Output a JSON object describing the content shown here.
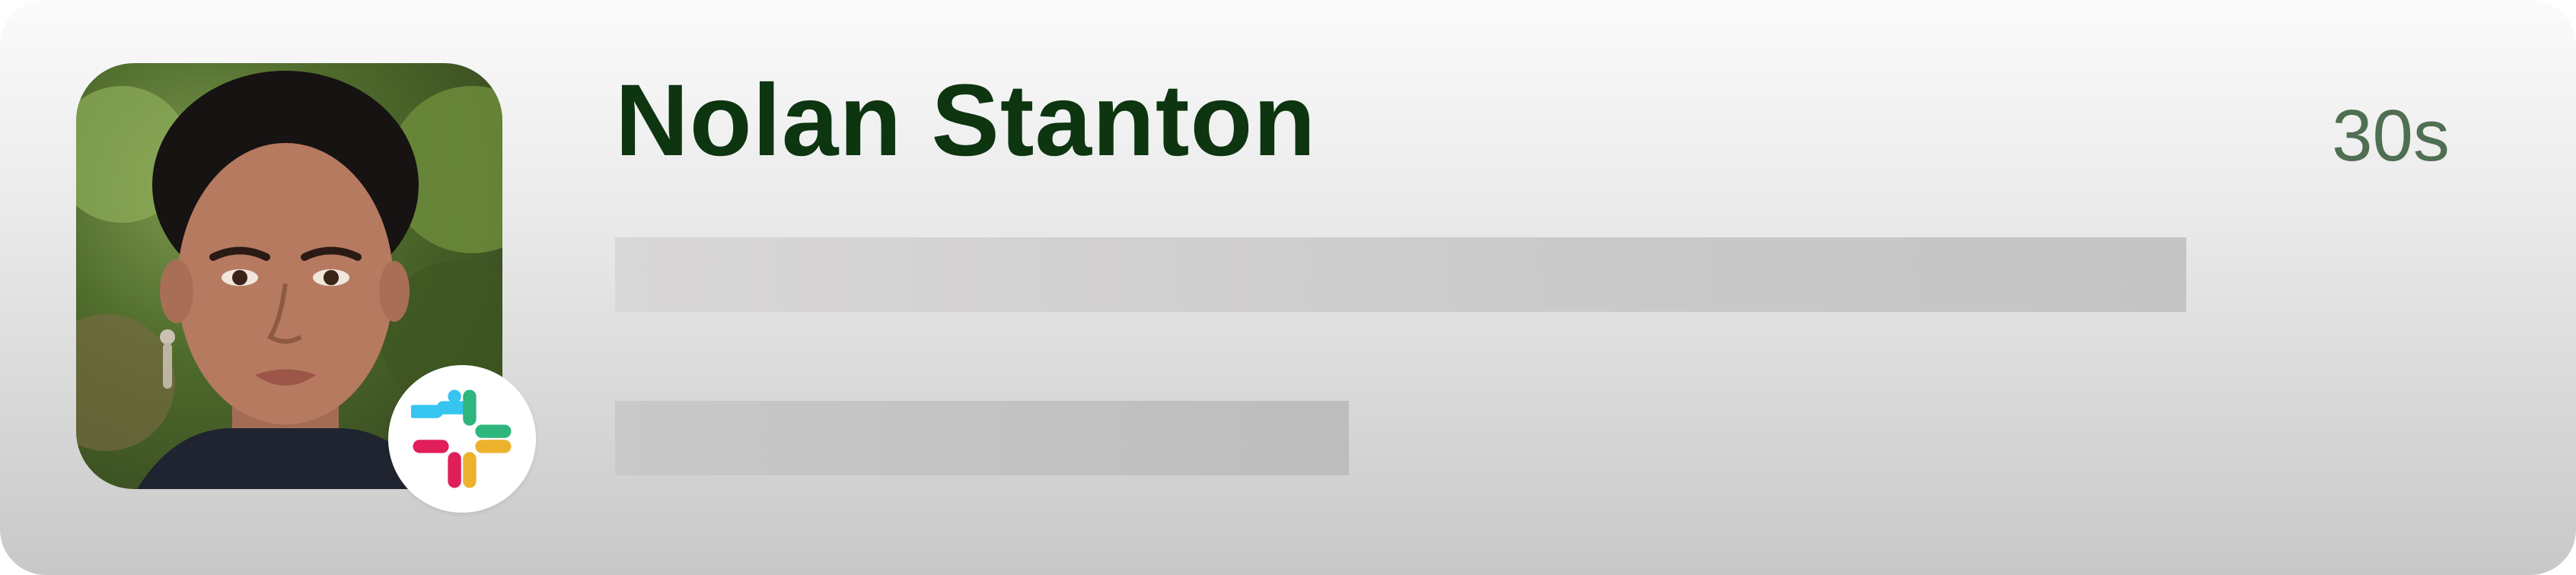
{
  "notification": {
    "sender_name": "Nolan Stanton",
    "timestamp": "30s",
    "avatar_icon": "person-photo",
    "app_badge_icon": "slack-logo-icon",
    "message_placeholder_lines": 2
  },
  "colors": {
    "name_text": "#0d3510",
    "timestamp_text": "#4f6e52",
    "slack_blue": "#36C5F0",
    "slack_green": "#2EB67D",
    "slack_yellow": "#ECB22E",
    "slack_red": "#E01E5A"
  }
}
